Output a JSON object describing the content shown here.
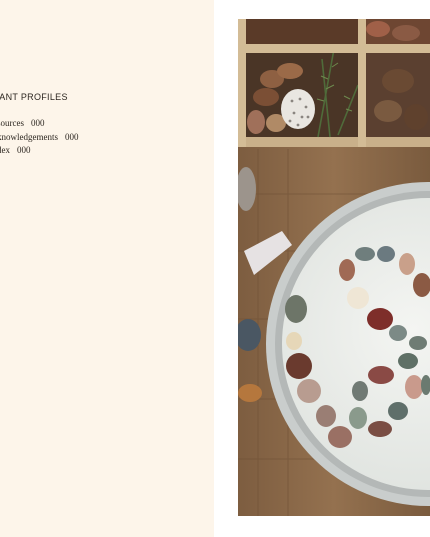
{
  "left_page": {
    "heading": "LANT PROFILES",
    "toc": [
      {
        "label": "sources",
        "page": "000"
      },
      {
        "label": "knowledgements",
        "page": "000"
      },
      {
        "label": "dex",
        "page": "000"
      }
    ]
  },
  "colors": {
    "paper": "#fdf5ea",
    "text": "#2c2620",
    "wood": "#8a6a4a",
    "bowl_rim": "#cfd3d3",
    "bowl_inner": "#eef0ed"
  }
}
